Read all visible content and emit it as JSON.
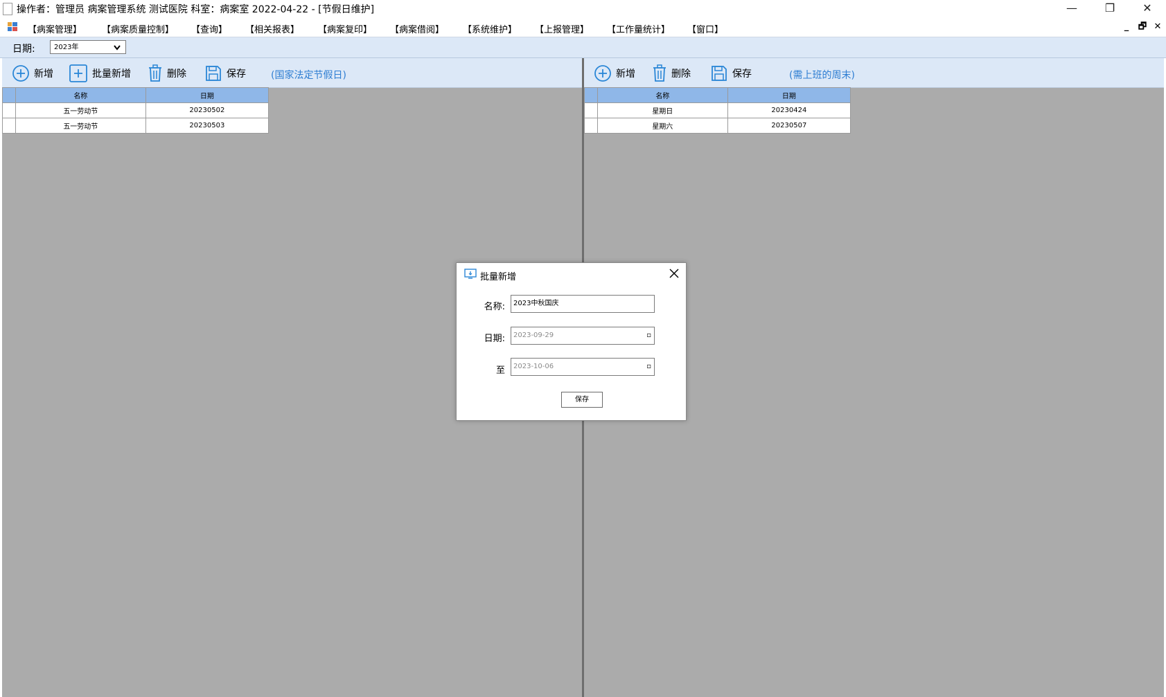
{
  "window": {
    "title": "操作者：管理员  病案管理系统  测试医院  科室：病案室  2022-04-22 - [节假日维护]",
    "controls": {
      "minimize": "—",
      "restore": "❐",
      "close": "✕"
    }
  },
  "menu": {
    "items": [
      "【病案管理】",
      "【病案质量控制】",
      "【查询】",
      "【相关报表】",
      "【病案复印】",
      "【病案借阅】",
      "【系统维护】",
      "【上报管理】",
      "【工作量统计】",
      "【窗口】"
    ],
    "mdi_controls": {
      "minimize": "_",
      "restore": "🗗",
      "close": "✕"
    }
  },
  "filter": {
    "date_label": "日期:",
    "year_value": "2023年"
  },
  "left_panel": {
    "toolbar": {
      "add": "新增",
      "batch_add": "批量新增",
      "delete": "删除",
      "save": "保存"
    },
    "hint": "(国家法定节假日)",
    "columns": [
      "名称",
      "日期"
    ],
    "rows": [
      {
        "name": "五一劳动节",
        "date": "20230502"
      },
      {
        "name": "五一劳动节",
        "date": "20230503"
      }
    ]
  },
  "right_panel": {
    "toolbar": {
      "add": "新增",
      "delete": "删除",
      "save": "保存"
    },
    "hint": "(需上班的周末)",
    "columns": [
      "名称",
      "日期"
    ],
    "rows": [
      {
        "name": "星期日",
        "date": "20230424"
      },
      {
        "name": "星期六",
        "date": "20230507"
      }
    ]
  },
  "dialog": {
    "title": "批量新增",
    "name_label": "名称:",
    "name_value": "2023中秋国庆",
    "date_label": "日期:",
    "date_from": "2023-09-29",
    "to_label": "至",
    "date_to": "2023-10-06",
    "save_label": "保存"
  },
  "colors": {
    "accent_text": "#2d7dd2",
    "icon_blue": "#2a86d6",
    "header_blue": "#8fb7e8",
    "toolbar_bg": "#dce8f7",
    "panel_bg": "#ababab"
  }
}
